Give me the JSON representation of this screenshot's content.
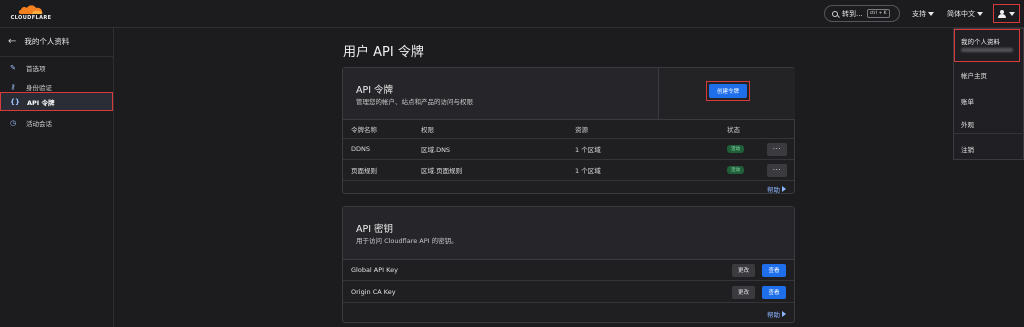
{
  "header": {
    "logo_text": "CLOUDFLARE",
    "search_label": "转到...",
    "search_shortcut": "ctrl + K",
    "support_label": "支持",
    "language_label": "简体中文"
  },
  "sidebar": {
    "back_label": "我的个人资料",
    "items": [
      {
        "label": "首选项",
        "icon": "pencil-icon"
      },
      {
        "label": "身份验证",
        "icon": "key-icon"
      },
      {
        "label": "API 令牌",
        "icon": "code-braces-icon"
      },
      {
        "label": "活动会话",
        "icon": "clock-icon"
      }
    ]
  },
  "main": {
    "page_title": "用户 API 令牌",
    "tokens_card": {
      "title": "API 令牌",
      "subtitle": "管理您的帐户、站点和产品的访问与权限",
      "create_button": "创建令牌",
      "columns": [
        "令牌名称",
        "权限",
        "资源",
        "状态"
      ],
      "rows": [
        {
          "name": "DDNS",
          "permission": "区域.DNS",
          "resource": "1 个区域",
          "status": "活动",
          "menu": "···"
        },
        {
          "name": "页面规则",
          "permission": "区域.页面规则",
          "resource": "1 个区域",
          "status": "活动",
          "menu": "···"
        }
      ],
      "help_label": "帮助"
    },
    "keys_card": {
      "title": "API 密钥",
      "subtitle": "用于访问 Cloudflare API 的密钥。",
      "rows": [
        {
          "name": "Global API Key",
          "change_label": "更改",
          "view_label": "查看"
        },
        {
          "name": "Origin CA Key",
          "change_label": "更改",
          "view_label": "查看"
        }
      ],
      "help_label": "帮助"
    }
  },
  "user_menu": {
    "profile_label": "我的个人资料",
    "items": [
      "帐户主页",
      "账单",
      "外观",
      "注销"
    ]
  },
  "colors": {
    "accent": "#1f6feb",
    "highlight": "#d63a3a",
    "logo_orange": "#f48120",
    "active_badge": "#1f5f3a"
  }
}
